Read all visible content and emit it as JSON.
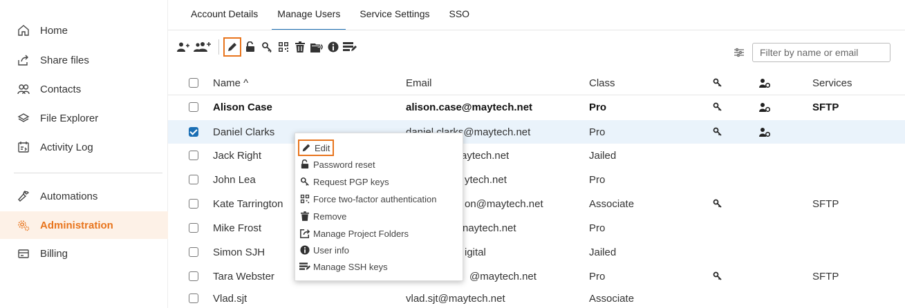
{
  "sidebar": {
    "items": [
      {
        "label": "Home",
        "icon": "home-icon"
      },
      {
        "label": "Share files",
        "icon": "share-icon"
      },
      {
        "label": "Contacts",
        "icon": "contacts-icon"
      },
      {
        "label": "File Explorer",
        "icon": "layers-icon"
      },
      {
        "label": "Activity Log",
        "icon": "activity-log-icon"
      },
      {
        "label": "Automations",
        "icon": "wrench-icon"
      },
      {
        "label": "Administration",
        "icon": "gears-icon"
      },
      {
        "label": "Billing",
        "icon": "card-icon"
      }
    ],
    "active_color": "#e8741c"
  },
  "tabs": [
    {
      "label": "Account Details"
    },
    {
      "label": "Manage Users"
    },
    {
      "label": "Service Settings"
    },
    {
      "label": "SSO"
    }
  ],
  "toolbar": {
    "icons": [
      "add-user-icon",
      "add-users-icon",
      "edit-icon",
      "unlock-icon",
      "key-icon",
      "qr-icon",
      "trash-icon",
      "share-folder-icon",
      "info-icon",
      "ssh-keys-icon"
    ],
    "filter_placeholder": "Filter by name or email"
  },
  "table": {
    "headers": {
      "name": "Name ^",
      "email": "Email",
      "class": "Class",
      "services": "Services"
    },
    "rows": [
      {
        "name": "Alison Case",
        "email": "alison.case@maytech.net",
        "class": "Pro",
        "services": "SFTP"
      },
      {
        "name": "Daniel Clarks",
        "email": "daniel.clarks@maytech.net",
        "class": "Pro",
        "services": ""
      },
      {
        "name": "Jack Right",
        "email": "aytech.net",
        "class": "Jailed",
        "services": ""
      },
      {
        "name": "John Lea",
        "email": "ytech.net",
        "class": "Pro",
        "services": ""
      },
      {
        "name": "Kate Tarrington",
        "email": "on@maytech.net",
        "class": "Associate",
        "services": "SFTP"
      },
      {
        "name": "Mike Frost",
        "email": "naytech.net",
        "class": "Pro",
        "services": ""
      },
      {
        "name": "Simon SJH",
        "email": "igital",
        "class": "Jailed",
        "services": ""
      },
      {
        "name": "Tara Webster",
        "email": "@maytech.net",
        "class": "Pro",
        "services": "SFTP"
      },
      {
        "name": "Vlad.sjt",
        "email": "vlad.sjt@maytech.net",
        "class": "Associate",
        "services": ""
      }
    ]
  },
  "context_menu": {
    "items": [
      {
        "label": "Edit",
        "icon": "pencil-icon"
      },
      {
        "label": "Password reset",
        "icon": "unlock-icon"
      },
      {
        "label": "Request PGP keys",
        "icon": "key-icon"
      },
      {
        "label": "Force two-factor authentication",
        "icon": "qr-icon"
      },
      {
        "label": "Remove",
        "icon": "trash-icon"
      },
      {
        "label": "Manage Project Folders",
        "icon": "share-folder-icon"
      },
      {
        "label": "User info",
        "icon": "info-icon"
      },
      {
        "label": "Manage SSH keys",
        "icon": "ssh-keys-icon"
      }
    ]
  },
  "colors": {
    "accent": "#e8741c",
    "primary": "#1b6fb5",
    "selected_row": "#eaf3fb"
  }
}
